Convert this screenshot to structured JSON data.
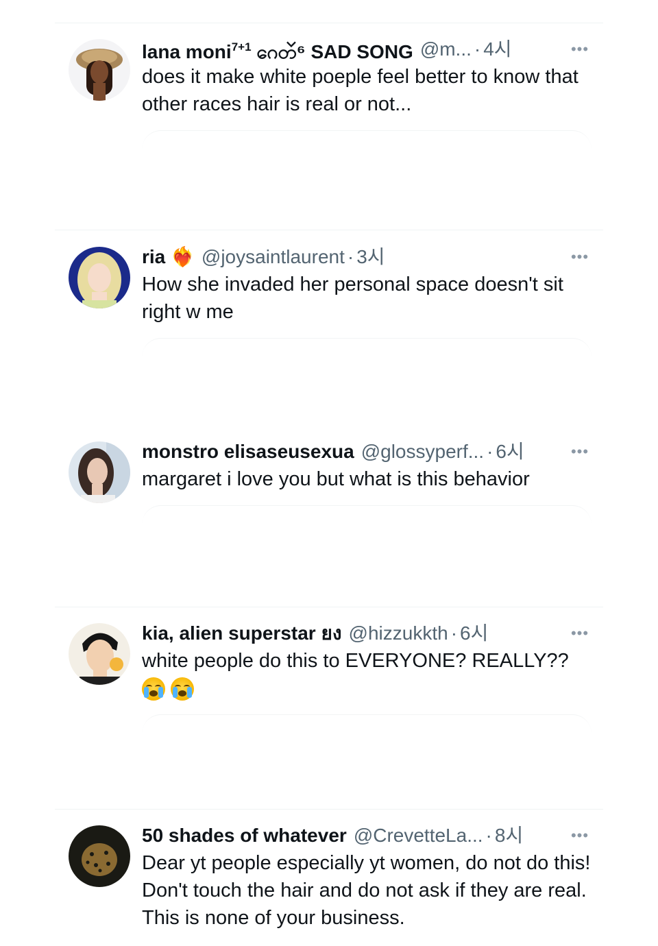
{
  "replies": [
    {
      "name": "lana moni",
      "name_sup": "7+1",
      "name_suffix": "ဂေတၴ⁶ SAD SONG",
      "handle": "@m...",
      "time": "4시",
      "text": "does it make white poeple feel better to know that other races hair is real or not...",
      "avatar_icon": "avatar-woman-brown-hat-icon"
    },
    {
      "name": "ria",
      "name_suffix": "❤️‍🔥",
      "handle": "@joysaintlaurent",
      "time": "3시",
      "text": "How she invaded her personal space doesn't sit right w me",
      "avatar_icon": "avatar-blonde-woman-icon"
    },
    {
      "name": "monstro elisaseusexua",
      "handle": "@glossyperf...",
      "time": "6시",
      "text": "margaret i love you but what is this behavior",
      "avatar_icon": "avatar-brunette-woman-icon"
    },
    {
      "name": "kia, alien superstar ยง",
      "handle": "@hizzukkth",
      "time": "6시",
      "text": "white people do this to EVERYONE? REALLY??",
      "emojis": [
        "loudly-crying-face",
        "loudly-crying-face"
      ],
      "avatar_icon": "avatar-cartoon-man-icon"
    },
    {
      "name": "50 shades of whatever",
      "handle": "@CrevetteLa...",
      "time": "8시",
      "text": "Dear yt people especially yt women, do not do this! Don't touch the hair and do not ask if they are real.  This is none of your business.",
      "avatar_icon": "avatar-leopard-icon"
    }
  ],
  "more_glyph": "•••",
  "separator_dot": "·",
  "colors": {
    "text_primary": "#0f1419",
    "text_secondary": "#536471",
    "divider": "#eff3f4"
  }
}
